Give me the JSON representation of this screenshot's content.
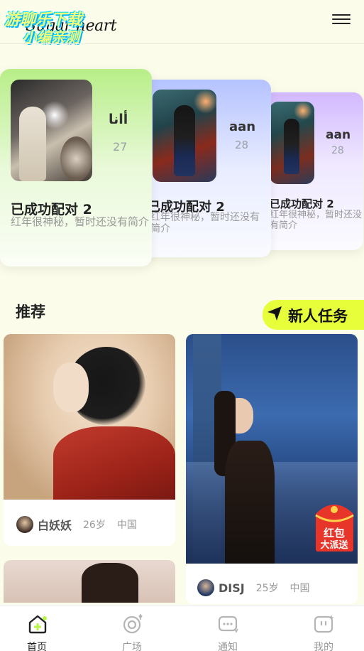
{
  "header": {
    "logo_script": "Sugar heart",
    "logo_line1": "游聊乐下载",
    "logo_line2": "小编亲测"
  },
  "matches": [
    {
      "name": "أانا",
      "age": "27",
      "title": "已成功配对 2",
      "intro": "红年很神秘，暂时还没有简介"
    },
    {
      "name": "aan",
      "age": "28",
      "title": "已成功配对 2",
      "intro": "红年很神秘，暂时还没有简介"
    },
    {
      "name": "aan",
      "age": "28",
      "title": "已成功配对 2",
      "intro": "红年很神秘，暂时还没有简介"
    }
  ],
  "section": {
    "title": "推荐",
    "task_label": "新人任务"
  },
  "feed": [
    {
      "name": "白妖妖",
      "age": "26岁",
      "location": "中国"
    },
    {
      "name": "DISJ",
      "age": "25岁",
      "location": "中国"
    }
  ],
  "promo": {
    "line1": "红包",
    "line2": "大派送"
  },
  "tabs": [
    {
      "label": "首页",
      "icon": "home-icon",
      "active": true
    },
    {
      "label": "广场",
      "icon": "plaza-icon",
      "active": false
    },
    {
      "label": "通知",
      "icon": "notification-icon",
      "active": false
    },
    {
      "label": "我的",
      "icon": "profile-icon",
      "active": false
    }
  ],
  "colors": {
    "background": "#fbfdea",
    "accent_yellow": "#e6ff3a",
    "card_green": "#b8ee88",
    "card_blue": "#b5c3ff",
    "card_purple": "#d2b8ff"
  }
}
